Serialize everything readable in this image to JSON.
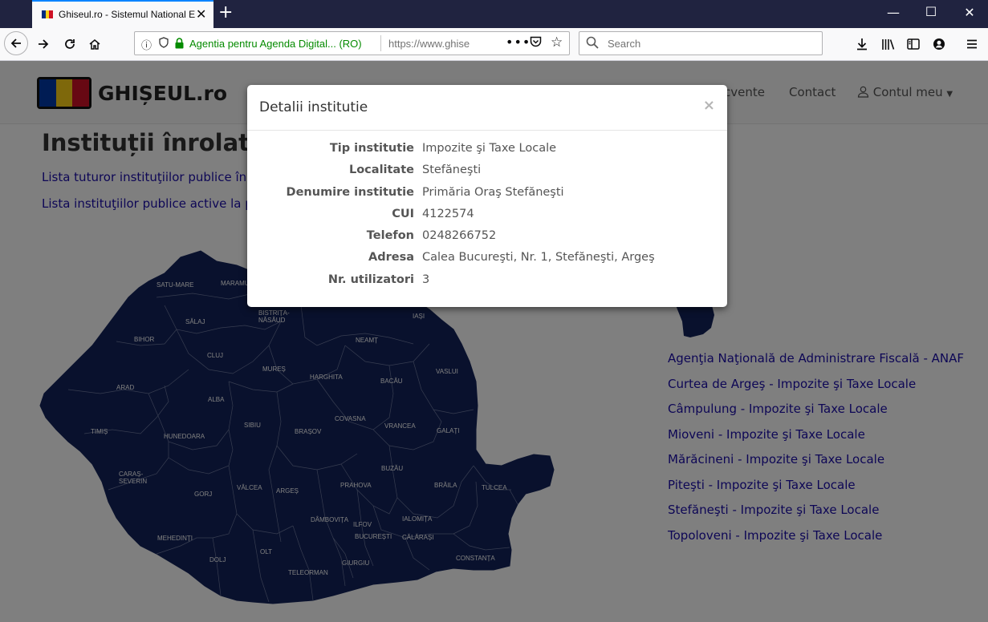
{
  "browser": {
    "tab_title": "Ghiseul.ro - Sistemul National E",
    "identity": "Agentia pentru Agenda Digital...  (RO)",
    "url": "https://www.ghise",
    "search_placeholder": "Search",
    "ui_color": "#0a84ff",
    "identity_color": "#058b00"
  },
  "header": {
    "logo_text": "GHIȘEUL.ro",
    "nav": {
      "frequent_partial": "cvente",
      "contact": "Contact",
      "account": "Contul meu"
    }
  },
  "page": {
    "title": "Instituții înrolate",
    "link_all": "Lista tuturor instituţiilor publice înrol",
    "link_active": "Lista instituţiilor publice active la plat"
  },
  "map": {
    "fill_color": "#13235b",
    "counties": [
      "SATU-MARE",
      "MARAMU",
      "BISTRIȚA-NĂSĂUD",
      "IAȘI",
      "SĂLAJ",
      "BIHOR",
      "NEAMȚ",
      "CLUJ",
      "MUREȘ",
      "HARGHITA",
      "VASLUI",
      "BACĂU",
      "ARAD",
      "ALBA",
      "COVASNA",
      "TIMIȘ",
      "HUNEDOARA",
      "SIBIU",
      "BRAȘOV",
      "VRANCEA",
      "GALAȚI",
      "BUZĂU",
      "CARAȘ-SEVERIN",
      "GORJ",
      "VÂLCEA",
      "ARGEȘ",
      "PRAHOVA",
      "BRĂILA",
      "TULCEA",
      "DÂMBOVIȚA",
      "ILFOV",
      "IALOMIȚA",
      "MEHEDINȚI",
      "BUCUREȘTI",
      "CĂLĂRAȘI",
      "OLT",
      "DOLJ",
      "CONSTANȚA",
      "GIURGIU",
      "TELEORMAN"
    ]
  },
  "institutions": [
    "Agenţia Naţională de Administrare Fiscală - ANAF",
    "Curtea de Argeş - Impozite şi Taxe Locale",
    "Câmpulung - Impozite şi Taxe Locale",
    "Mioveni - Impozite şi Taxe Locale",
    "Mărăcineni - Impozite şi Taxe Locale",
    "Piteşti - Impozite şi Taxe Locale",
    "Stefăneşti - Impozite şi Taxe Locale",
    "Topoloveni - Impozite şi Taxe Locale"
  ],
  "modal": {
    "title": "Detalii institutie",
    "close": "×",
    "rows": [
      {
        "label": "Tip institutie",
        "value": "Impozite şi Taxe Locale"
      },
      {
        "label": "Localitate",
        "value": "Stefăneşti"
      },
      {
        "label": "Denumire institutie",
        "value": "Primăria Oraş Stefăneşti"
      },
      {
        "label": "CUI",
        "value": "4122574"
      },
      {
        "label": "Telefon",
        "value": "0248266752"
      },
      {
        "label": "Adresa",
        "value": "Calea Bucureşti, Nr. 1, Stefăneşti, Argeş"
      },
      {
        "label": "Nr. utilizatori",
        "value": "3"
      }
    ]
  }
}
